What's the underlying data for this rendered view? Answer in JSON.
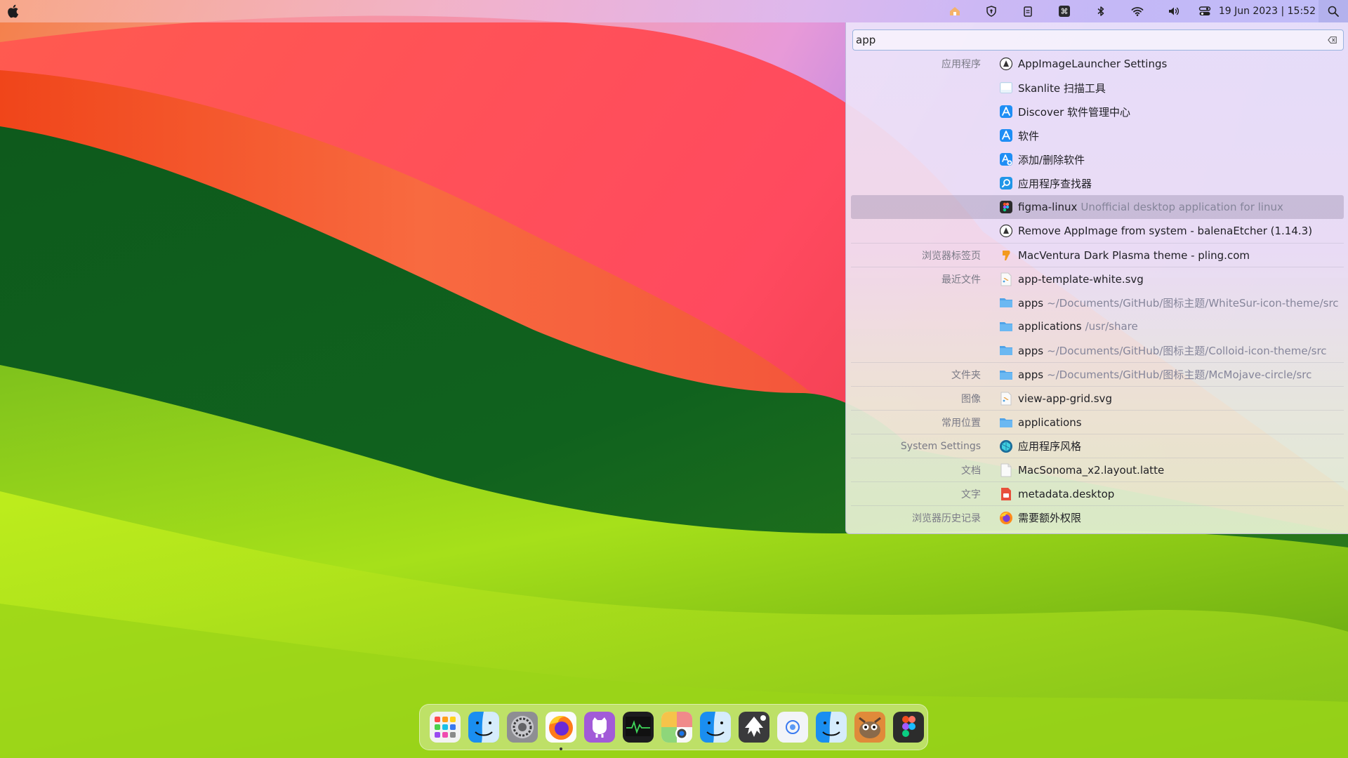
{
  "menubar": {
    "clock": "19 Jun 2023 | 15:52",
    "tray_icons": [
      "home-icon",
      "shield-icon",
      "clipboard-icon",
      "command-icon",
      "bluetooth-icon",
      "wifi-icon",
      "volume-icon",
      "control-center-icon"
    ]
  },
  "krunner": {
    "query": "app",
    "results": [
      {
        "category": "应用程序",
        "label": "AppImageLauncher Settings",
        "sub": "",
        "icon": "appimage-icon"
      },
      {
        "category": "",
        "label": "Skanlite 扫描工具",
        "sub": "",
        "icon": "scanner-icon"
      },
      {
        "category": "",
        "label": "Discover 软件管理中心",
        "sub": "",
        "icon": "discover-icon"
      },
      {
        "category": "",
        "label": "软件",
        "sub": "",
        "icon": "software-icon"
      },
      {
        "category": "",
        "label": "添加/删除软件",
        "sub": "",
        "icon": "add-remove-software-icon"
      },
      {
        "category": "",
        "label": "应用程序查找器",
        "sub": "",
        "icon": "app-finder-icon"
      },
      {
        "category": "",
        "label": "figma-linux",
        "sub": "Unofficial desktop application for linux",
        "icon": "figma-icon"
      },
      {
        "category": "",
        "label": "Remove AppImage from system - balenaEtcher (1.14.3)",
        "sub": "",
        "icon": "appimage-icon"
      },
      {
        "category": "浏览器标签页",
        "label": "MacVentura Dark Plasma theme - pling.com",
        "sub": "",
        "icon": "pling-icon"
      },
      {
        "category": "最近文件",
        "label": "app-template-white.svg",
        "sub": "",
        "icon": "svg-file-icon"
      },
      {
        "category": "",
        "label": "apps",
        "sub": "~/Documents/GitHub/图标主题/WhiteSur-icon-theme/src",
        "icon": "folder-icon"
      },
      {
        "category": "",
        "label": "applications",
        "sub": "/usr/share",
        "icon": "folder-icon"
      },
      {
        "category": "",
        "label": "apps",
        "sub": "~/Documents/GitHub/图标主题/Colloid-icon-theme/src",
        "icon": "folder-icon"
      },
      {
        "category": "文件夹",
        "label": "apps",
        "sub": "~/Documents/GitHub/图标主题/McMojave-circle/src",
        "icon": "folder-icon"
      },
      {
        "category": "图像",
        "label": "view-app-grid.svg",
        "sub": "",
        "icon": "svg-file-icon"
      },
      {
        "category": "常用位置",
        "label": "applications",
        "sub": "",
        "icon": "folder-icon"
      },
      {
        "category": "System Settings",
        "label": "应用程序风格",
        "sub": "",
        "icon": "app-style-icon"
      },
      {
        "category": "文档",
        "label": "MacSonoma_x2.layout.latte",
        "sub": "",
        "icon": "document-icon"
      },
      {
        "category": "文字",
        "label": "metadata.desktop",
        "sub": "",
        "icon": "desktop-file-icon"
      },
      {
        "category": "浏览器历史记录",
        "label": "需要额外权限",
        "sub": "",
        "icon": "firefox-icon"
      }
    ]
  },
  "dock": {
    "items": [
      "launchpad",
      "finder",
      "system-settings",
      "firefox",
      "github-desktop",
      "system-monitor",
      "chrome",
      "finder-2",
      "inkscape",
      "browser",
      "finder-3",
      "gimp",
      "figma"
    ]
  }
}
